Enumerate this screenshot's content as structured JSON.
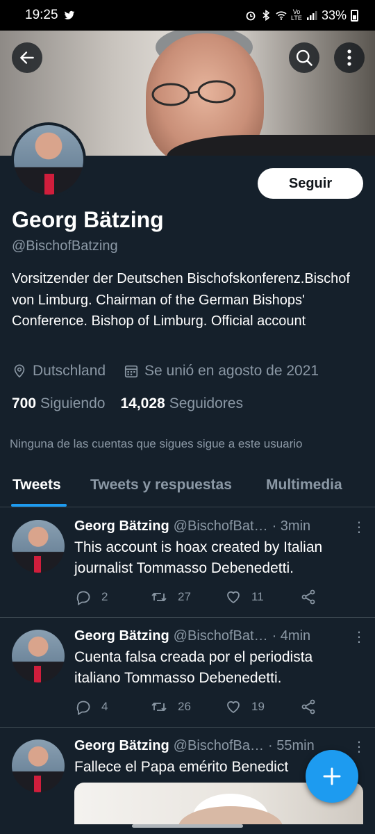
{
  "status_bar": {
    "time": "19:25",
    "battery": "33%",
    "network_label": "Vo LTE"
  },
  "profile": {
    "name": "Georg Bätzing",
    "handle": "@BischofBatzing",
    "follow_label": "Seguir",
    "bio": "Vorsitzender der Deutschen Bischofskonferenz.Bischof von Limburg. Chairman of the German Bishops' Conference. Bishop of Limburg. Official account",
    "location": "Dutschland",
    "joined": "Se unió en agosto de 2021",
    "following_count": "700",
    "following_label": "Siguiendo",
    "followers_count": "14,028",
    "followers_label": "Seguidores",
    "notice": "Ninguna de las cuentas que sigues sigue a este usuario"
  },
  "tabs": [
    "Tweets",
    "Tweets y respuestas",
    "Multimedia"
  ],
  "tweets": [
    {
      "name": "Georg Bätzing",
      "handle": "@BischofBat…",
      "time": "· 3min",
      "text": "This account is hoax created by Italian journalist Tommasso Debenedetti.",
      "replies": "2",
      "retweets": "27",
      "likes": "11"
    },
    {
      "name": "Georg Bätzing",
      "handle": "@BischofBat…",
      "time": "· 4min",
      "text": "Cuenta falsa creada por el periodista italiano Tommasso Debenedetti.",
      "replies": "4",
      "retweets": "26",
      "likes": "19"
    },
    {
      "name": "Georg Bätzing",
      "handle": "@BischofBa…",
      "time": "· 55min",
      "text": "Fallece el Papa emérito Benedict"
    }
  ],
  "colors": {
    "background": "#15202b",
    "accent": "#1d9bf0",
    "muted": "#8b98a5",
    "divider": "#38444d"
  },
  "icons": [
    "back-arrow-icon",
    "search-icon",
    "more-vertical-icon",
    "location-pin-icon",
    "calendar-icon",
    "reply-icon",
    "retweet-icon",
    "like-icon",
    "share-icon",
    "compose-plus-icon",
    "twitter-bird-icon"
  ]
}
